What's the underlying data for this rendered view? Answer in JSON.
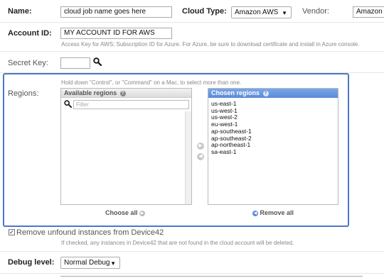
{
  "name": {
    "label": "Name:",
    "value": "cloud job name goes here"
  },
  "cloud_type": {
    "label": "Cloud Type:",
    "selected": "Amazon AWS"
  },
  "vendor": {
    "label": "Vendor:",
    "value": "Amazon"
  },
  "account_id": {
    "label": "Account ID:",
    "value": "MY ACCOUNT ID FOR AWS",
    "help": "Access Key for AWS; Subscription ID for Azure. For Azure, be sure to download certificate and install in Azure console."
  },
  "secret_key": {
    "label": "Secret Key:",
    "value": "",
    "search_icon": "search-icon"
  },
  "regions": {
    "label": "Regions:",
    "hint": "Hold down \"Control\", or \"Command\" on a Mac, to select more than one.",
    "available": {
      "title": "Available regions",
      "filter_placeholder": "Filter",
      "items": []
    },
    "chosen": {
      "title": "Chosen regions",
      "items": [
        "us-east-1",
        "us-west-1",
        "us-west-2",
        "eu-west-1",
        "ap-southeast-1",
        "ap-southeast-2",
        "ap-northeast-1",
        "sa-east-1"
      ]
    },
    "choose_all": "Choose all",
    "remove_all": "Remove all"
  },
  "remove_unfound": {
    "label": "Remove unfound instances from Device42",
    "checked": true,
    "help": "If checked, any instances in Device42 that are not found in the cloud account will be deleted."
  },
  "debug_level": {
    "label": "Debug level:",
    "selected": "Normal Debug"
  },
  "colors": {
    "focus": "#4a77c9",
    "chosen_header": "#5b8ad8"
  }
}
